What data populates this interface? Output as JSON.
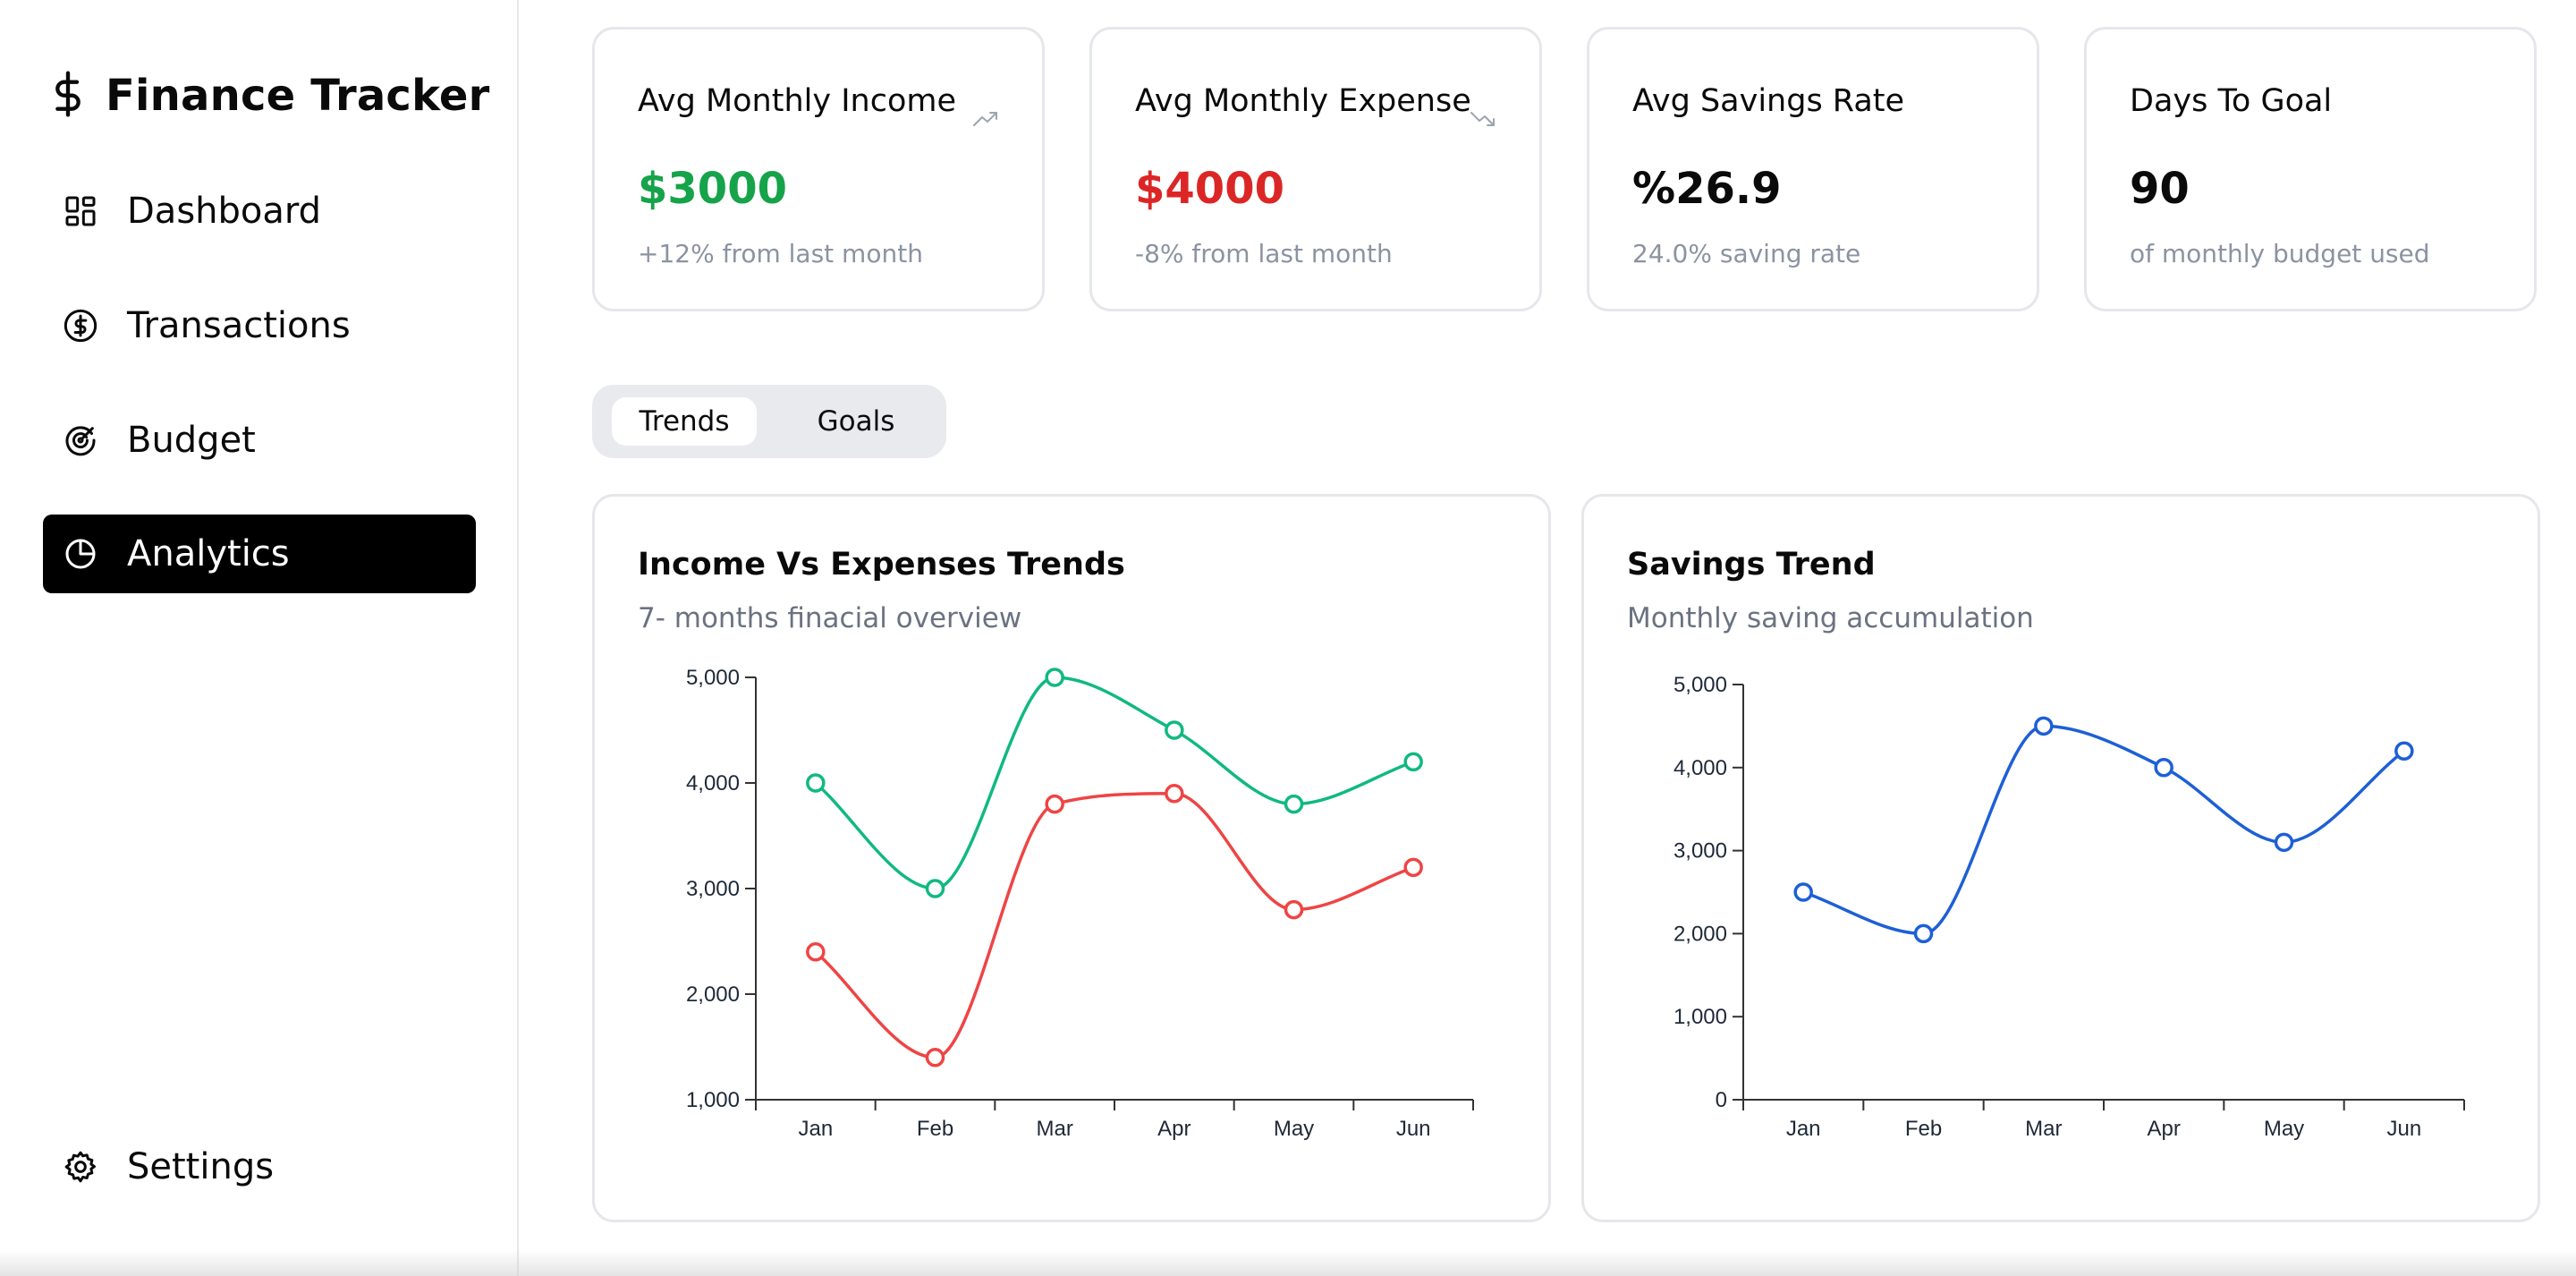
{
  "app": {
    "title": "Finance Tracker",
    "logo_icon": "dollar-icon"
  },
  "sidebar": {
    "items": [
      {
        "label": "Dashboard",
        "icon": "dashboard-grid-icon",
        "active": false
      },
      {
        "label": "Transactions",
        "icon": "dollar-circle-icon",
        "active": false
      },
      {
        "label": "Budget",
        "icon": "target-icon",
        "active": false
      },
      {
        "label": "Analytics",
        "icon": "pie-chart-icon",
        "active": true
      }
    ],
    "settings_label": "Settings",
    "settings_icon": "gear-icon"
  },
  "stats": [
    {
      "title": "Avg Monthly Income",
      "value": "$3000",
      "sub": "+12% from last month",
      "value_color": "#16a34a",
      "trend_icon": "trending-up-icon"
    },
    {
      "title": "Avg Monthly Expense",
      "value": "$4000",
      "sub": "-8% from last month",
      "value_color": "#dc2626",
      "trend_icon": "trending-down-icon"
    },
    {
      "title": "Avg Savings Rate",
      "value": "%26.9",
      "sub": "24.0% saving rate",
      "value_color": "#0a0a0a"
    },
    {
      "title": "Days To Goal",
      "value": "90",
      "sub": "of monthly budget used",
      "value_color": "#0a0a0a"
    }
  ],
  "tabs": {
    "items": [
      "Trends",
      "Goals"
    ],
    "active": "Trends"
  },
  "charts": {
    "income_expense": {
      "title": "Income Vs Expenses Trends",
      "subtitle": "7- months finacial overview"
    },
    "savings": {
      "title": "Savings Trend",
      "subtitle": "Monthly saving accumulation"
    }
  },
  "colors": {
    "income": "#10b981",
    "expense": "#ef4444",
    "savings": "#1d5fd6",
    "accent_active": "#000000"
  },
  "chart_data": [
    {
      "type": "line",
      "categories": [
        "Jan",
        "Feb",
        "Mar",
        "Apr",
        "May",
        "Jun"
      ],
      "series": [
        {
          "values": [
            4000,
            3000,
            5000,
            4500,
            3800,
            4200
          ],
          "color": "#10b981"
        },
        {
          "values": [
            2400,
            1400,
            3800,
            3900,
            2800,
            3200
          ],
          "color": "#ef4444"
        }
      ],
      "ylim": [
        1000,
        5000
      ],
      "yticks": [
        1000,
        2000,
        3000,
        4000,
        5000
      ],
      "ytick_labels": [
        "1,000",
        "2,000",
        "3,000",
        "4,000",
        "5,000"
      ],
      "grid": false
    },
    {
      "type": "line",
      "categories": [
        "Jan",
        "Feb",
        "Mar",
        "Apr",
        "May",
        "Jun"
      ],
      "series": [
        {
          "values": [
            2500,
            2000,
            4500,
            4000,
            3100,
            4200
          ],
          "color": "#1d5fd6"
        }
      ],
      "ylim": [
        0,
        5000
      ],
      "yticks": [
        0,
        1000,
        2000,
        3000,
        4000,
        5000
      ],
      "ytick_labels": [
        "0",
        "1,000",
        "2,000",
        "3,000",
        "4,000",
        "5,000"
      ],
      "grid": false
    }
  ]
}
